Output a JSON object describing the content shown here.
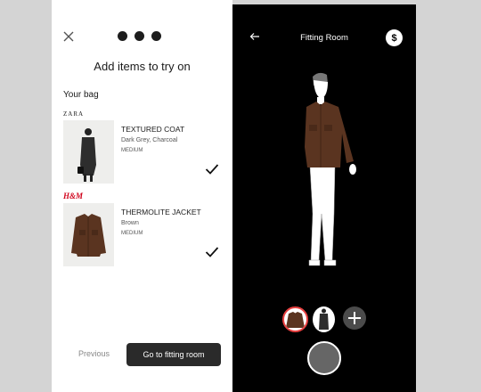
{
  "left": {
    "title": "Add items to try on",
    "bag_label": "Your bag",
    "items": [
      {
        "brand": "ZARA",
        "name": "TEXTURED COAT",
        "color": "Dark Grey, Charcoal",
        "size": "MEDIUM",
        "checked": true
      },
      {
        "brand": "H&M",
        "name": "THERMOLITE JACKET",
        "color": "Brown",
        "size": "MEDIUM",
        "checked": true
      }
    ],
    "prev_label": "Previous",
    "go_label": "Go to fitting room"
  },
  "right": {
    "title": "Fitting Room",
    "currency_symbol": "$"
  },
  "colors": {
    "accent_ring": "#e84040",
    "jacket_brown": "#5a3420",
    "coat_grey": "#3a3a3a"
  }
}
